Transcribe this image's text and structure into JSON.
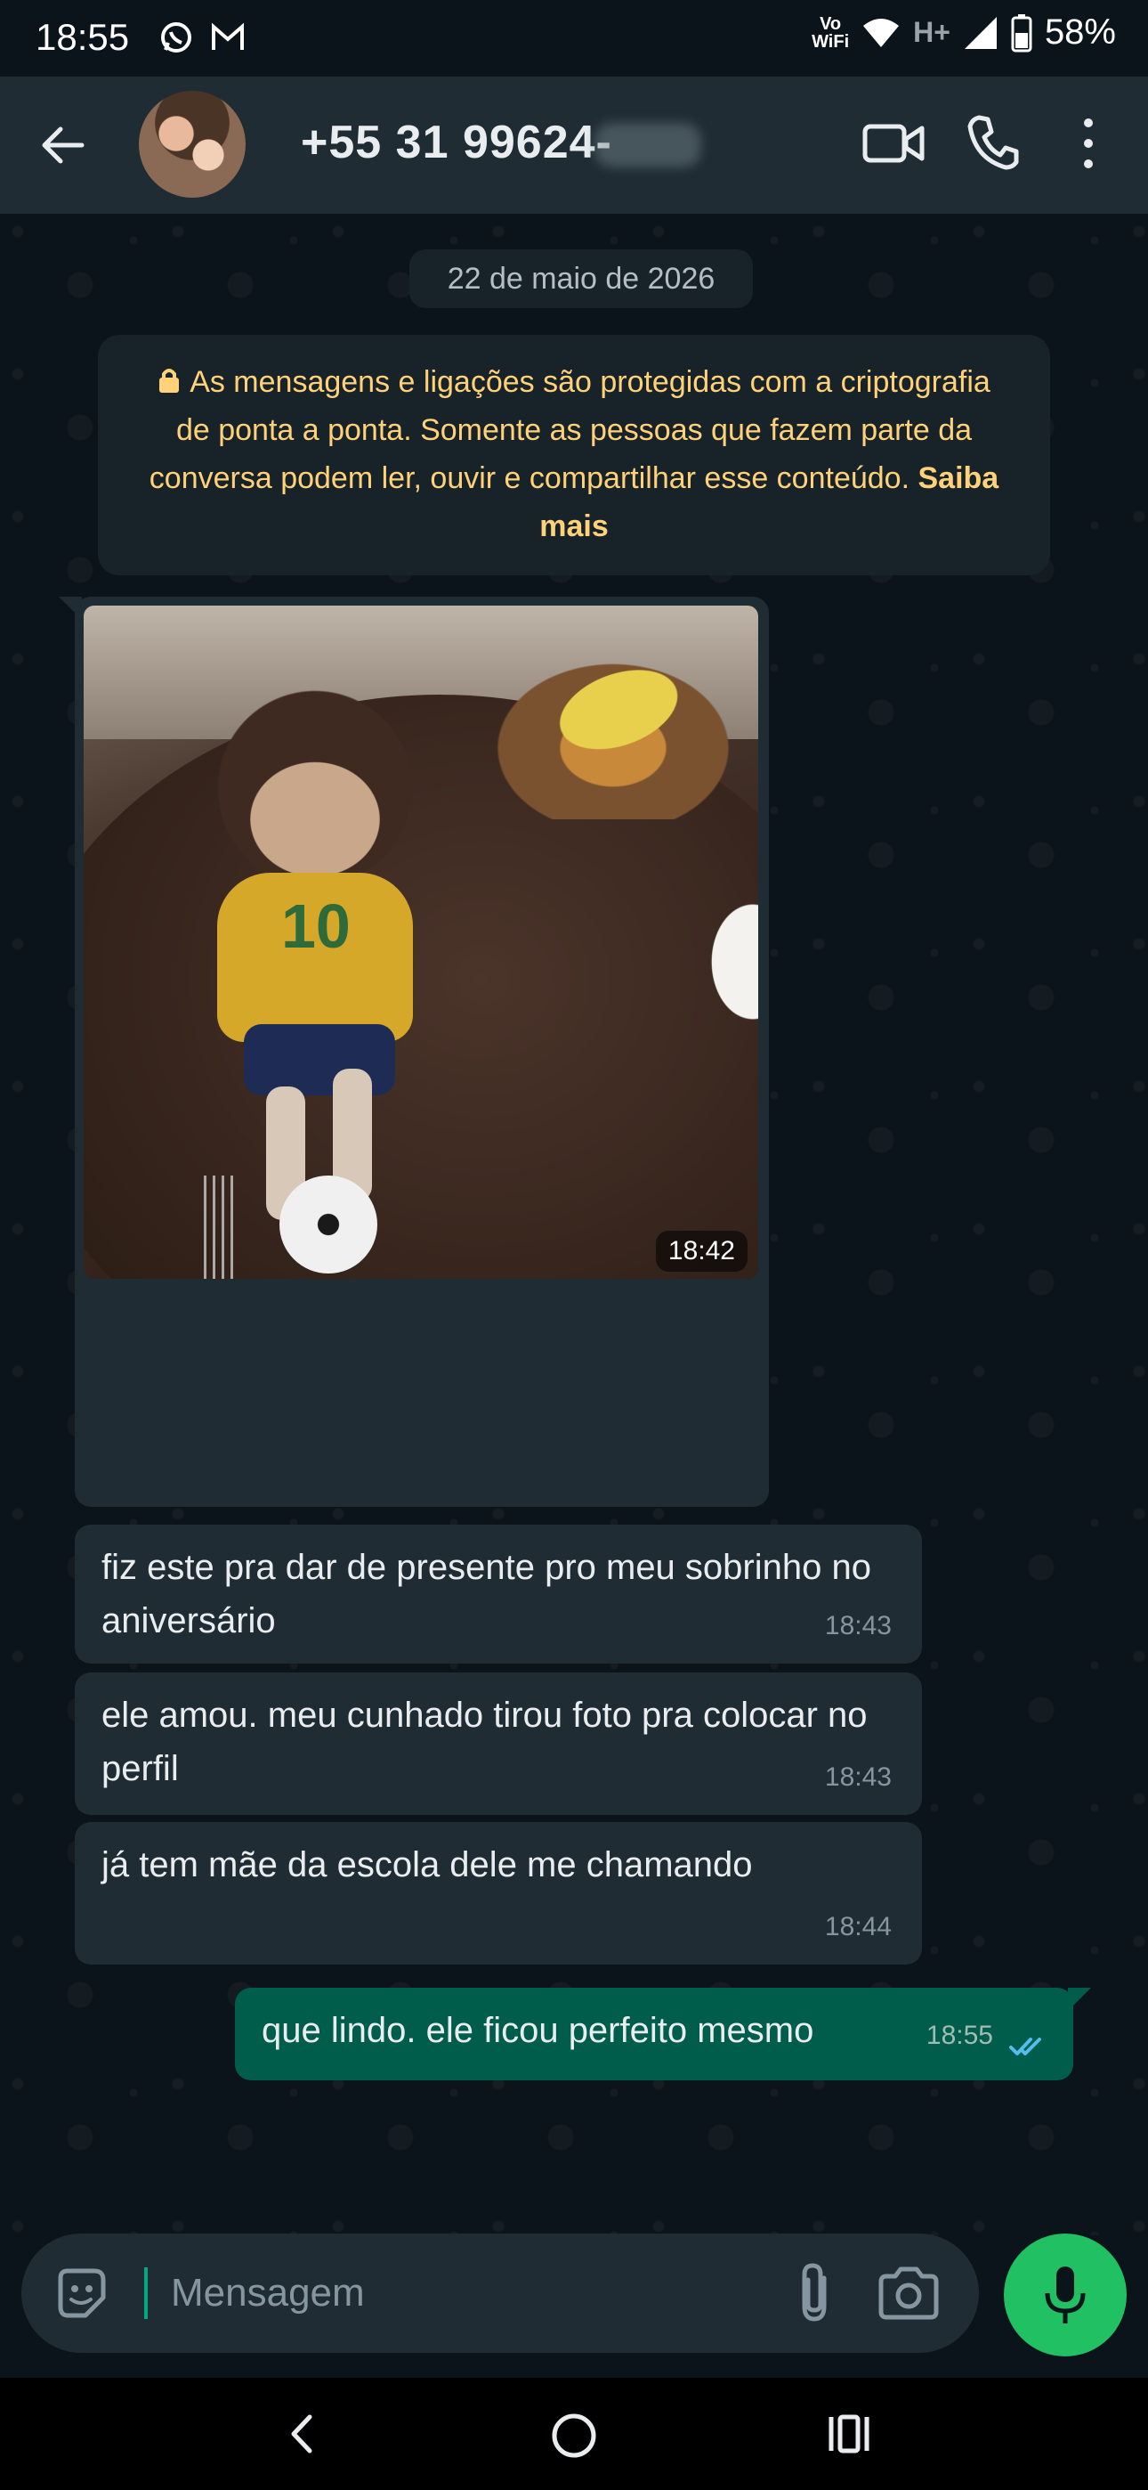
{
  "status_bar": {
    "time": "18:55",
    "vowifi_top": "Vo",
    "vowifi_bottom": "WiFi",
    "network": "H+",
    "battery": "58%"
  },
  "header": {
    "contact_name": "+55 31 99624-",
    "icons": [
      "back-arrow-icon",
      "video-camera-icon",
      "phone-icon",
      "more-vertical-icon"
    ]
  },
  "chat": {
    "date_chip": "22 de maio de 2026",
    "encryption_notice": {
      "text": "As mensagens e ligações são protegidas com a criptografia de ponta a ponta. Somente as pessoas que fazem parte da conversa podem ler, ouvir e compartilhar esse conteúdo.",
      "link": "Saiba mais"
    },
    "image_message": {
      "time": "18:42"
    },
    "messages": [
      {
        "direction": "in",
        "text": "fiz este pra dar de presente pro meu sobrinho no aniversário",
        "time": "18:43"
      },
      {
        "direction": "in",
        "text": "ele amou. meu cunhado tirou foto pra colocar no perfil",
        "time": "18:43"
      },
      {
        "direction": "in",
        "text": "já tem mãe da escola dele me chamando",
        "time": "18:44"
      },
      {
        "direction": "out",
        "text": "que lindo. ele ficou perfeito mesmo",
        "time": "18:55",
        "status": "read"
      }
    ]
  },
  "composer": {
    "placeholder": "Mensagem",
    "value": ""
  },
  "colors": {
    "background": "#0b141a",
    "header": "#1f2c33",
    "incoming_bubble": "#1f2c34",
    "outgoing_bubble": "#005c4b",
    "accent": "#21c063",
    "notice_text": "#ffd279",
    "read_ticks": "#53bdeb"
  }
}
